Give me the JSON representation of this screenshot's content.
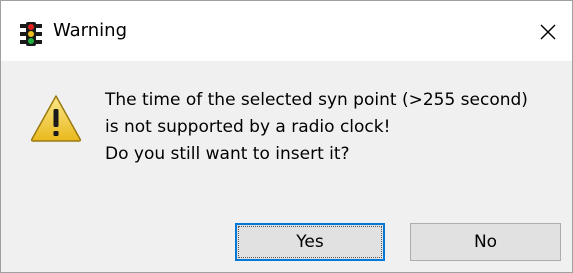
{
  "window": {
    "title": "Warning",
    "close_icon": "close-icon",
    "app_icon": "traffic-light-icon"
  },
  "message": {
    "icon": "warning-icon",
    "lines": [
      "The time of the selected syn point (>255 second)",
      "is not supported by a radio clock!",
      "Do you still want to insert it?"
    ]
  },
  "buttons": {
    "yes_label": "Yes",
    "no_label": "No"
  },
  "colors": {
    "focus_border": "#0078d7",
    "button_face": "#e1e1e1",
    "dialog_body": "#f0f0f0",
    "warning_fill": "#f6d44a"
  }
}
